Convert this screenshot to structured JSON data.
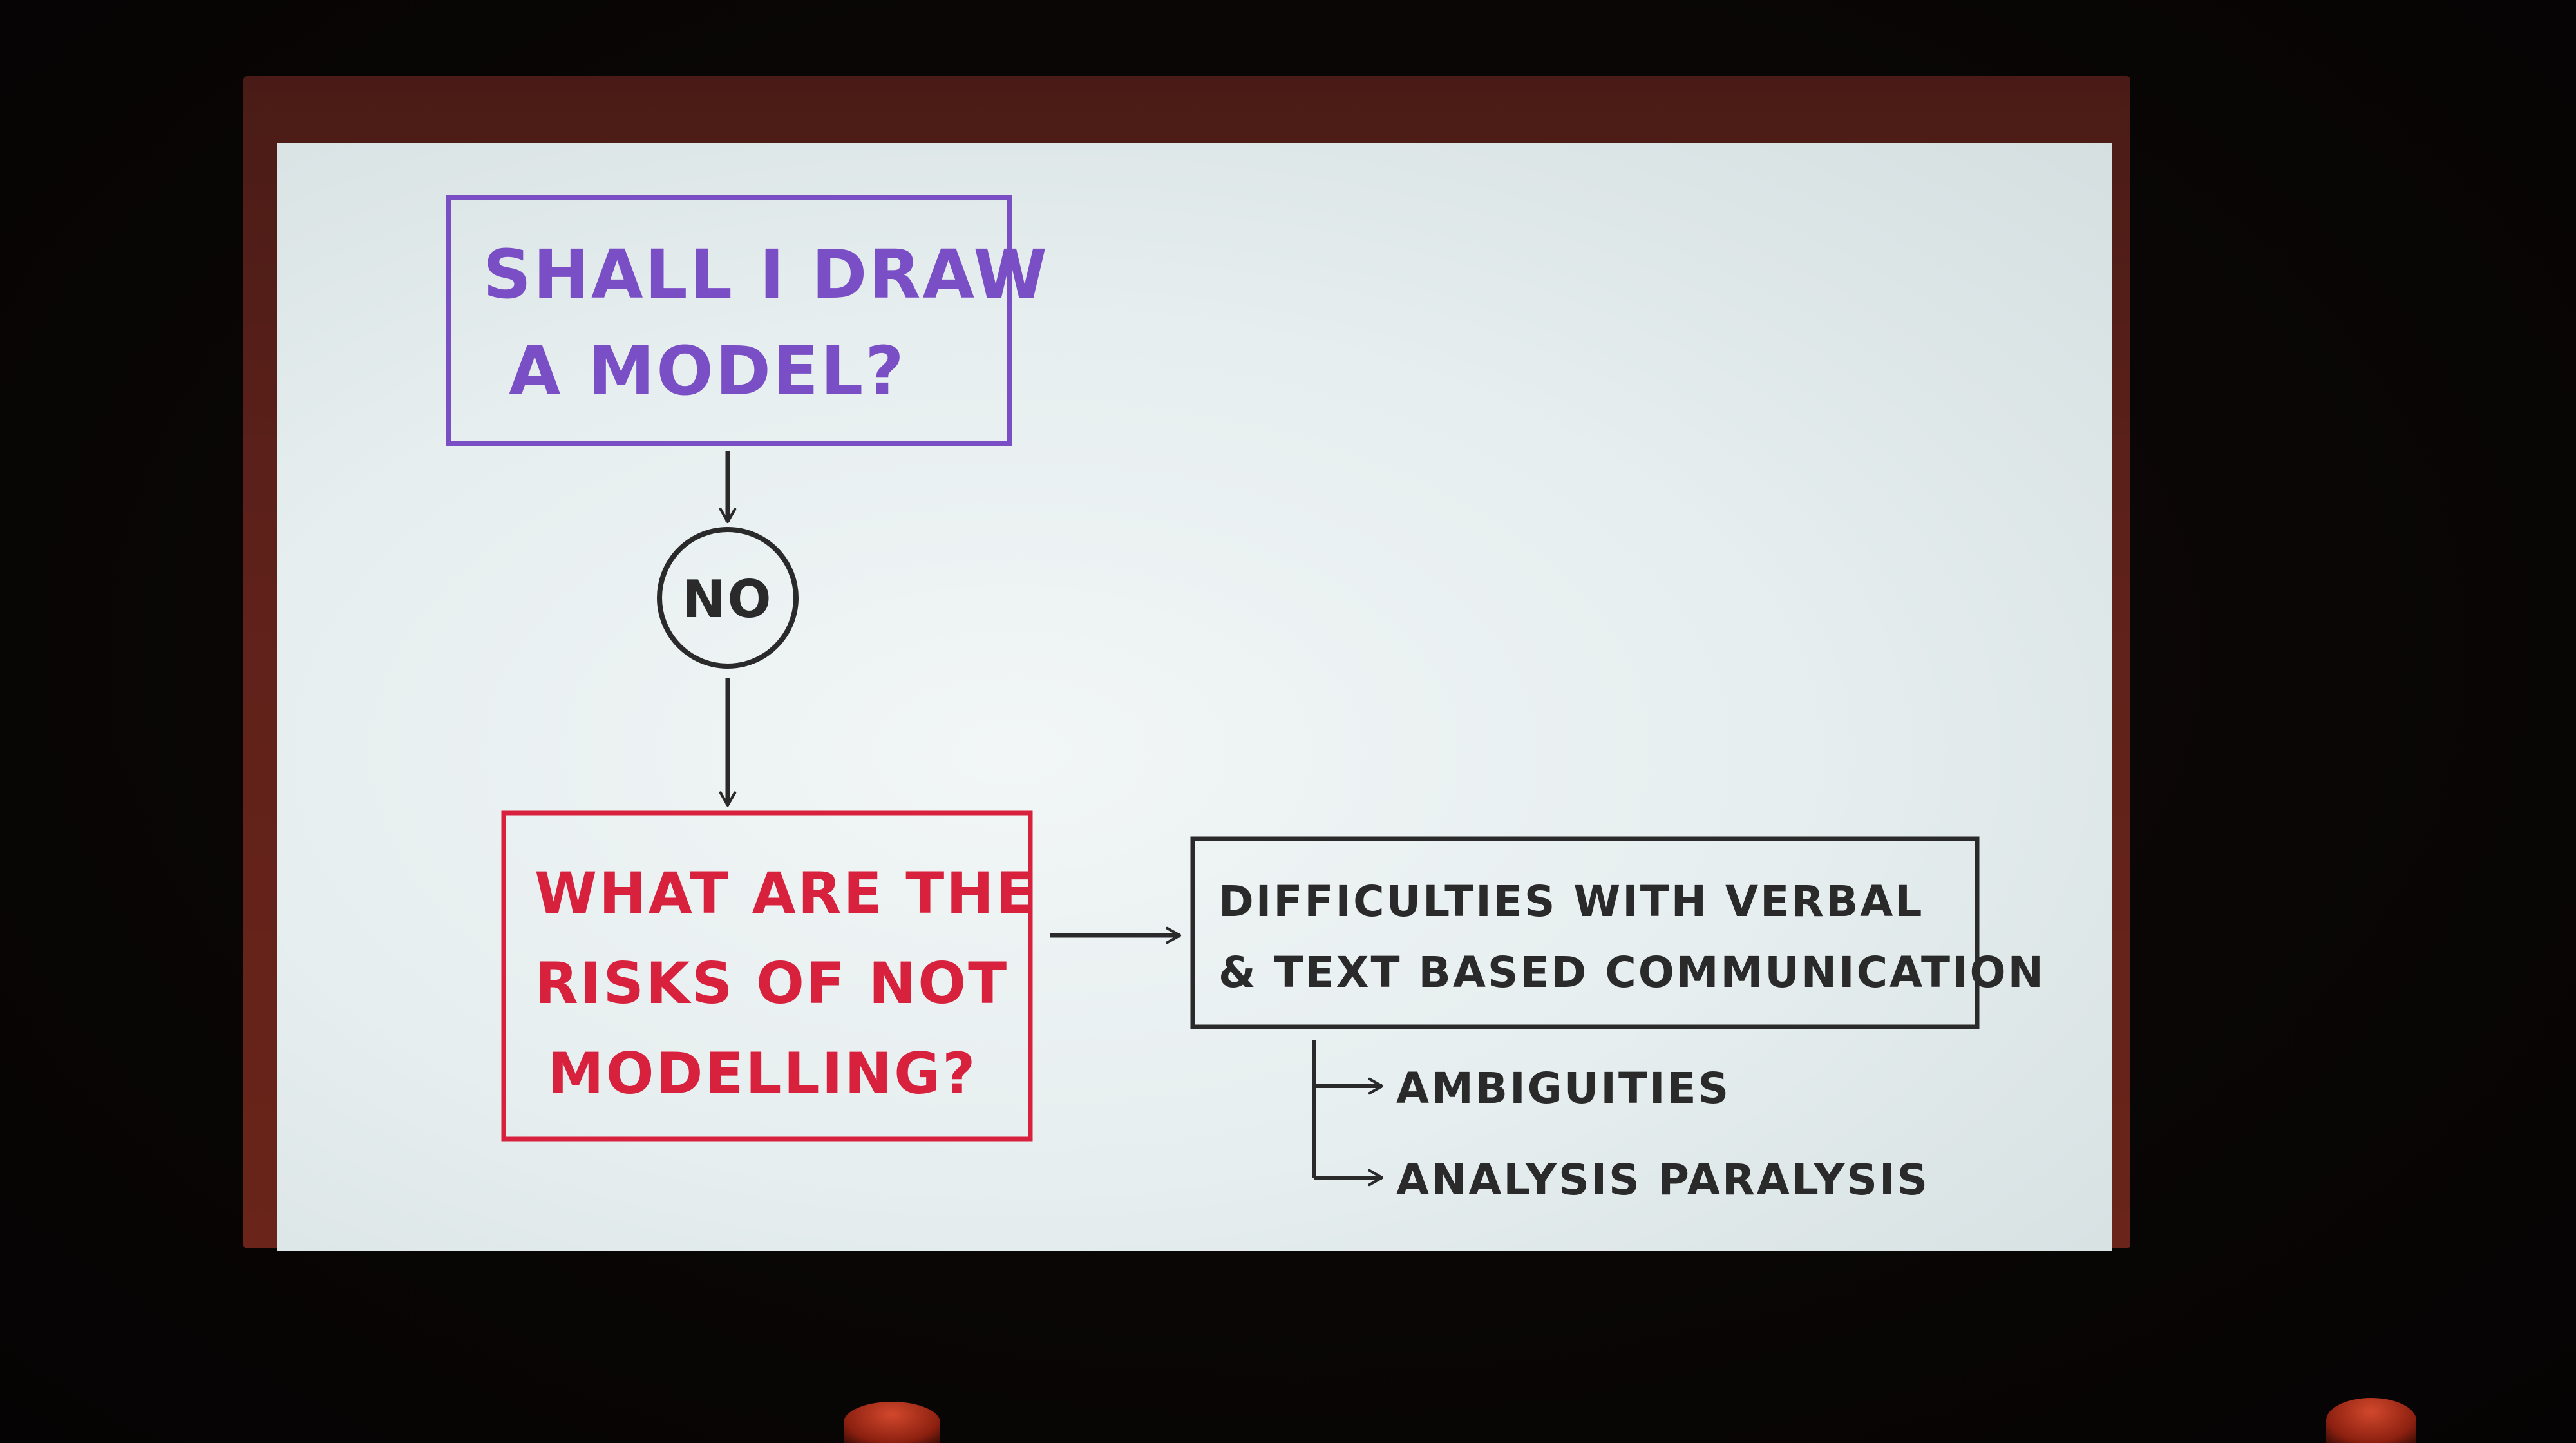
{
  "flowchart": {
    "question": [
      "SHALL I DRAW",
      "A MODEL?"
    ],
    "answer": "NO",
    "risk_question": [
      "WHAT ARE THE",
      "RISKS OF NOT",
      "MODELLING?"
    ],
    "difficulty": [
      "DIFFICULTIES WITH VERBAL",
      "& TEXT BASED COMMUNICATION"
    ],
    "consequences": [
      "AMBIGUITIES",
      "ANALYSIS PARALYSIS"
    ]
  },
  "colors": {
    "question_ink": "#7a4fc6",
    "risk_ink": "#d8213d",
    "default_ink": "#2a2a2a",
    "slide_background": "#eaf0f1",
    "screen_frame": "#5e211a"
  }
}
